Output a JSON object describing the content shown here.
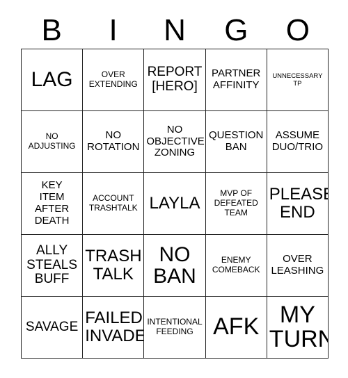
{
  "card": {
    "title": "BINGO",
    "header_letters": [
      "B",
      "I",
      "N",
      "G",
      "O"
    ],
    "grid_size": "5x5",
    "colors": {
      "background": "#ffffff",
      "text": "#000000",
      "grid_line": "#222222"
    },
    "cells": [
      {
        "text": "LAG",
        "size": "s-xxl"
      },
      {
        "text": "OVER\nEXTENDING",
        "size": "s-sm"
      },
      {
        "text": "REPORT\n[HERO]",
        "size": "s-lg"
      },
      {
        "text": "PARTNER\nAFFINITY",
        "size": "s-md"
      },
      {
        "text": "UNNECESSARY\nTP",
        "size": "s-xs"
      },
      {
        "text": "NO\nADJUSTING",
        "size": "s-sm"
      },
      {
        "text": "NO\nROTATION",
        "size": "s-md"
      },
      {
        "text": "NO\nOBJECTIVE\nZONING",
        "size": "s-md"
      },
      {
        "text": "QUESTION\nBAN",
        "size": "s-md"
      },
      {
        "text": "ASSUME\nDUO/TRIO",
        "size": "s-md"
      },
      {
        "text": "KEY\nITEM\nAFTER\nDEATH",
        "size": "s-md"
      },
      {
        "text": "ACCOUNT\nTRASHTALK",
        "size": "s-sm"
      },
      {
        "text": "LAYLA",
        "size": "s-xl"
      },
      {
        "text": "MVP OF\nDEFEATED\nTEAM",
        "size": "s-sm"
      },
      {
        "text": "PLEASE\nEND",
        "size": "s-xl"
      },
      {
        "text": "ALLY\nSTEALS\nBUFF",
        "size": "s-lg"
      },
      {
        "text": "TRASH\nTALK",
        "size": "s-xl"
      },
      {
        "text": "NO\nBAN",
        "size": "s-xxl"
      },
      {
        "text": "ENEMY\nCOMEBACK",
        "size": "s-sm"
      },
      {
        "text": "OVER\nLEASHING",
        "size": "s-md"
      },
      {
        "text": "SAVAGE",
        "size": "s-lg"
      },
      {
        "text": "FAILED\nINVADE",
        "size": "s-xl"
      },
      {
        "text": "INTENTIONAL\nFEEDING",
        "size": "s-sm"
      },
      {
        "text": "AFK",
        "size": "s-huge"
      },
      {
        "text": "MY\nTURN",
        "size": "s-huge"
      }
    ]
  }
}
